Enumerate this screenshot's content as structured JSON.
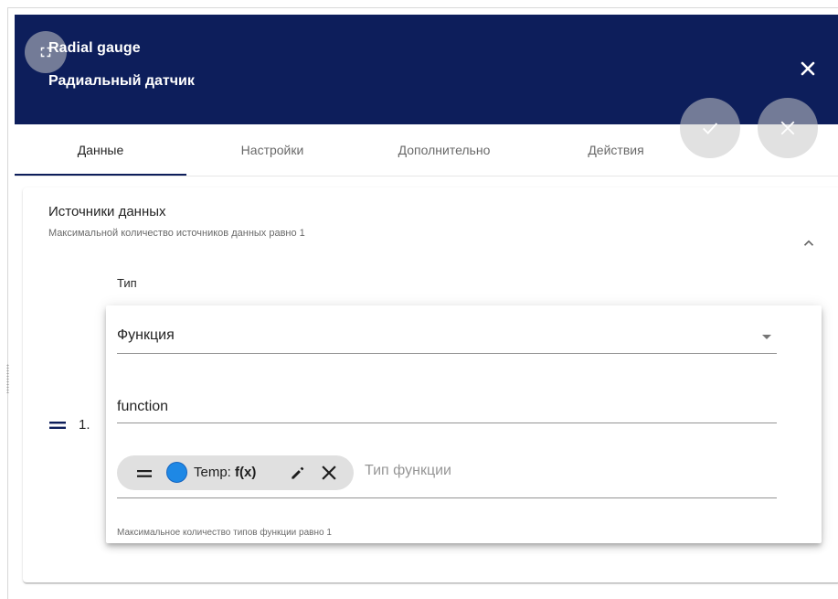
{
  "header": {
    "title": "Radial gauge",
    "subtitle": "Радиальный датчик",
    "fullscreen_icon": "fullscreen-icon",
    "close_icon": "close-icon",
    "background_color": "#0d1e5b"
  },
  "fab": {
    "apply_icon": "check-icon",
    "cancel_icon": "close-icon"
  },
  "tabs": [
    {
      "label": "Данные",
      "active": true
    },
    {
      "label": "Настройки",
      "active": false
    },
    {
      "label": "Дополнительно",
      "active": false
    },
    {
      "label": "Действия",
      "active": false
    }
  ],
  "datasources": {
    "title": "Источники данных",
    "hint": "Максимальной количество источников данных равно 1",
    "type_label": "Тип",
    "rows": [
      {
        "index": "1.",
        "type_value": "Функция",
        "function_value": "function",
        "chips": [
          {
            "label": "Temp: ",
            "func": "f(x)",
            "color": "#1e88e5"
          }
        ],
        "chip_input_placeholder": "Тип функции",
        "max_hint": "Максимальное количество типов функции равно 1"
      }
    ]
  }
}
